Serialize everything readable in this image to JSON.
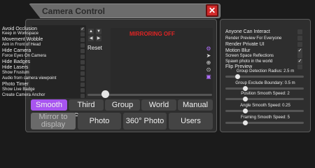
{
  "window": {
    "title": "Camera Control",
    "close_icon": "close-icon",
    "accent": "#d22a2a"
  },
  "options": [
    {
      "label": "Avoid Occlusion",
      "checked": true
    },
    {
      "label": "Keep in Workspace",
      "checked": false
    },
    {
      "label": "Movement Wobble",
      "checked": false
    },
    {
      "label": "Aim in Front of Head",
      "checked": false
    },
    {
      "label": "Hide Camera",
      "checked": false
    },
    {
      "label": "Force Eyes On Camera",
      "checked": false
    },
    {
      "label": "Hide Badges",
      "checked": false
    },
    {
      "label": "Hide Lasers",
      "checked": false
    },
    {
      "label": "Show Frustum",
      "checked": false
    },
    {
      "label": "Audio from camera viewpoint",
      "checked": false
    },
    {
      "label": "Photo Timer",
      "checked": false
    },
    {
      "label": "Show Live Badge",
      "checked": false
    },
    {
      "label": "Create Camera Anchor",
      "checked": false
    }
  ],
  "preview": {
    "status": "MIRRORING OFF",
    "status_color": "#e02424",
    "reset_label": "Reset"
  },
  "side_icons": [
    "gear-icon",
    "cursor-icon",
    "globe-icon",
    "location-pin-icon",
    "screen-icon"
  ],
  "modes": [
    "Smooth POV",
    "Third Person",
    "Group",
    "World",
    "Manual"
  ],
  "active_mode": "Smooth POV",
  "active_color": "#a855f0",
  "actions": [
    "Mirror to display",
    "Photo",
    "360° Photo",
    "Users"
  ],
  "toggles": [
    {
      "label": "Anyone Can Interact",
      "checked": false
    },
    {
      "label": "Render Preview For Everyone",
      "checked": false
    },
    {
      "label": "Render Private UI",
      "checked": false
    },
    {
      "label": "Motion Blur",
      "checked": true
    },
    {
      "label": "Screen Space Reflections",
      "checked": false
    },
    {
      "label": "Spawn photo in the world",
      "checked": true
    },
    {
      "label": "Flip Preview",
      "checked": false
    }
  ],
  "sliders": [
    {
      "label": "Group Detection Radius: 2.5 m",
      "value": 0.15
    },
    {
      "label": "Group Exclude Boundary: 0.5 m",
      "value": 0.25
    },
    {
      "label": "Position Smooth Speed: 2",
      "value": 0.25
    },
    {
      "label": "Angle Smooth Speed: 0.25",
      "value": 0.25
    },
    {
      "label": "Framing Smooth Speed: 5",
      "value": 0.25
    }
  ],
  "zoom_slider": {
    "value": 0.14
  }
}
